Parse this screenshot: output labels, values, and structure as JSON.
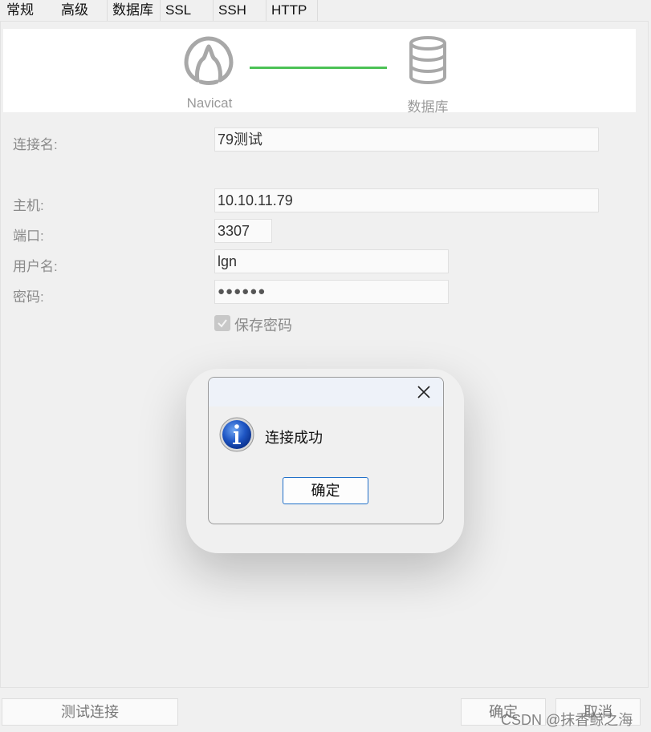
{
  "tabs": [
    {
      "label": "常规",
      "active": true
    },
    {
      "label": "高级"
    },
    {
      "label": "数据库"
    },
    {
      "label": "SSL"
    },
    {
      "label": "SSH"
    },
    {
      "label": "HTTP"
    }
  ],
  "banner": {
    "navicat_label": "Navicat",
    "database_label": "数据库",
    "link_color": "#4cc256"
  },
  "form": {
    "connection_name": {
      "label": "连接名:",
      "value": "79测试"
    },
    "host": {
      "label": "主机:",
      "value": "10.10.11.79"
    },
    "port": {
      "label": "端口:",
      "value": "3307"
    },
    "username": {
      "label": "用户名:",
      "value": "lgn"
    },
    "password": {
      "label": "密码:",
      "value": "●●●●●●"
    },
    "save_password": {
      "label": "保存密码",
      "checked": true
    }
  },
  "dialog": {
    "message": "连接成功",
    "ok_label": "确定",
    "icon": "info-icon",
    "close_icon": "close-icon"
  },
  "footer": {
    "test_label": "测试连接",
    "ok_label": "确定",
    "cancel_label": "取消"
  },
  "watermark": "CSDN @抹香鲸之海"
}
